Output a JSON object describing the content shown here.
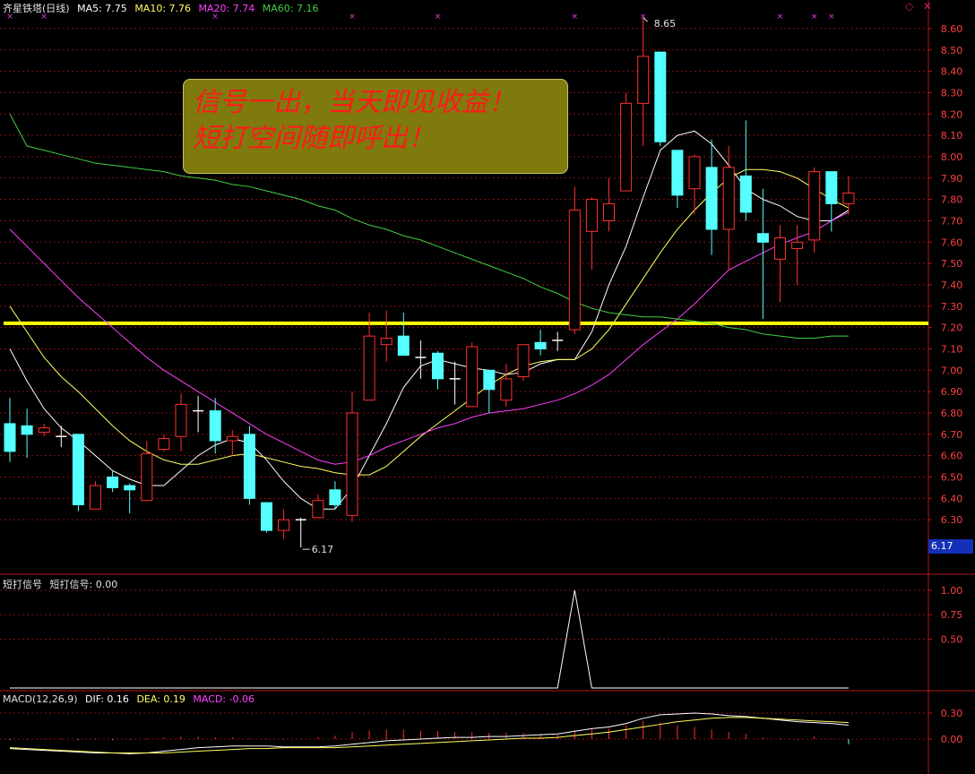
{
  "header": {
    "security_name": "齐星铁塔(日线)",
    "ma5_label": "MA5: 7.75",
    "ma10_label": "MA10: 7.76",
    "ma20_label": "MA20: 7.74",
    "ma60_label": "MA60: 7.16"
  },
  "banner": {
    "line1": "信号一出，当天即见收益！",
    "line2": "短打空间随即呼出！"
  },
  "current_price_tag": "6.17",
  "signal_panel": {
    "title": "短打信号",
    "value_label": "短打信号: 0.00"
  },
  "macd_panel": {
    "title": "MACD(12,26,9)",
    "dif_label": "DIF: 0.16",
    "dea_label": "DEA: 0.19",
    "macd_label": "MACD: -0.06"
  },
  "colors": {
    "up": "#ff3030",
    "down": "#54ffff",
    "ma5": "#ffffff",
    "ma10": "#ffff60",
    "ma20": "#ff40ff",
    "ma60": "#40d040",
    "support_line": "#ffff00",
    "grid": "#8a1010"
  },
  "chart_data": [
    {
      "type": "candlestick",
      "title": "齐星铁塔(日线)",
      "ylim": [
        6.2,
        8.65
      ],
      "yticks": [
        6.3,
        6.4,
        6.5,
        6.6,
        6.7,
        6.8,
        6.9,
        7.0,
        7.1,
        7.2,
        7.3,
        7.4,
        7.5,
        7.6,
        7.7,
        7.8,
        7.9,
        8.0,
        8.1,
        8.2,
        8.3,
        8.4,
        8.5,
        8.6
      ],
      "max_label": "8.65",
      "min_label": "6.17",
      "support_level": 7.22,
      "candles": [
        {
          "o": 6.75,
          "h": 6.87,
          "l": 6.57,
          "c": 6.62
        },
        {
          "o": 6.74,
          "h": 6.82,
          "l": 6.59,
          "c": 6.7
        },
        {
          "o": 6.71,
          "h": 6.75,
          "l": 6.69,
          "c": 6.73
        },
        {
          "o": 6.69,
          "h": 6.74,
          "l": 6.64,
          "c": 6.69
        },
        {
          "o": 6.7,
          "h": 6.7,
          "l": 6.34,
          "c": 6.37
        },
        {
          "o": 6.35,
          "h": 6.48,
          "l": 6.35,
          "c": 6.46
        },
        {
          "o": 6.5,
          "h": 6.53,
          "l": 6.43,
          "c": 6.45
        },
        {
          "o": 6.46,
          "h": 6.47,
          "l": 6.33,
          "c": 6.44
        },
        {
          "o": 6.39,
          "h": 6.67,
          "l": 6.39,
          "c": 6.61
        },
        {
          "o": 6.63,
          "h": 6.7,
          "l": 6.62,
          "c": 6.68
        },
        {
          "o": 6.69,
          "h": 6.89,
          "l": 6.62,
          "c": 6.84
        },
        {
          "o": 6.81,
          "h": 6.88,
          "l": 6.71,
          "c": 6.81
        },
        {
          "o": 6.81,
          "h": 6.87,
          "l": 6.61,
          "c": 6.67
        },
        {
          "o": 6.67,
          "h": 6.72,
          "l": 6.6,
          "c": 6.69
        },
        {
          "o": 6.7,
          "h": 6.74,
          "l": 6.37,
          "c": 6.4
        },
        {
          "o": 6.38,
          "h": 6.38,
          "l": 6.24,
          "c": 6.25
        },
        {
          "o": 6.25,
          "h": 6.35,
          "l": 6.21,
          "c": 6.3
        },
        {
          "o": 6.3,
          "h": 6.31,
          "l": 6.17,
          "c": 6.3
        },
        {
          "o": 6.31,
          "h": 6.42,
          "l": 6.31,
          "c": 6.39
        },
        {
          "o": 6.44,
          "h": 6.48,
          "l": 6.35,
          "c": 6.37
        },
        {
          "o": 6.32,
          "h": 6.9,
          "l": 6.29,
          "c": 6.8
        },
        {
          "o": 6.86,
          "h": 7.27,
          "l": 6.86,
          "c": 7.16
        },
        {
          "o": 7.12,
          "h": 7.28,
          "l": 7.04,
          "c": 7.15
        },
        {
          "o": 7.16,
          "h": 7.27,
          "l": 7.07,
          "c": 7.07
        },
        {
          "o": 7.06,
          "h": 7.14,
          "l": 6.96,
          "c": 7.06
        },
        {
          "o": 7.08,
          "h": 7.09,
          "l": 6.91,
          "c": 6.96
        },
        {
          "o": 6.96,
          "h": 7.04,
          "l": 6.84,
          "c": 6.96
        },
        {
          "o": 6.83,
          "h": 7.13,
          "l": 6.83,
          "c": 7.11
        },
        {
          "o": 7.0,
          "h": 7.0,
          "l": 6.8,
          "c": 6.91
        },
        {
          "o": 6.86,
          "h": 7.03,
          "l": 6.83,
          "c": 6.96
        },
        {
          "o": 6.97,
          "h": 7.12,
          "l": 6.95,
          "c": 7.12
        },
        {
          "o": 7.13,
          "h": 7.19,
          "l": 7.07,
          "c": 7.1
        },
        {
          "o": 7.14,
          "h": 7.18,
          "l": 7.09,
          "c": 7.13
        },
        {
          "o": 7.19,
          "h": 7.86,
          "l": 7.17,
          "c": 7.75
        },
        {
          "o": 7.65,
          "h": 7.81,
          "l": 7.47,
          "c": 7.8
        },
        {
          "o": 7.7,
          "h": 7.9,
          "l": 7.65,
          "c": 7.78
        },
        {
          "o": 7.84,
          "h": 8.3,
          "l": 7.84,
          "c": 8.25
        },
        {
          "o": 8.25,
          "h": 8.65,
          "l": 8.05,
          "c": 8.47
        },
        {
          "o": 8.49,
          "h": 8.49,
          "l": 8.05,
          "c": 8.07
        },
        {
          "o": 8.03,
          "h": 8.03,
          "l": 7.76,
          "c": 7.82
        },
        {
          "o": 7.85,
          "h": 8.01,
          "l": 7.73,
          "c": 8.0
        },
        {
          "o": 7.95,
          "h": 8.08,
          "l": 7.54,
          "c": 7.66
        },
        {
          "o": 7.66,
          "h": 8.05,
          "l": 7.47,
          "c": 7.95
        },
        {
          "o": 7.91,
          "h": 8.17,
          "l": 7.7,
          "c": 7.74
        },
        {
          "o": 7.64,
          "h": 7.85,
          "l": 7.24,
          "c": 7.6
        },
        {
          "o": 7.52,
          "h": 7.68,
          "l": 7.32,
          "c": 7.62
        },
        {
          "o": 7.57,
          "h": 7.68,
          "l": 7.4,
          "c": 7.6
        },
        {
          "o": 7.61,
          "h": 7.95,
          "l": 7.55,
          "c": 7.93
        },
        {
          "o": 7.93,
          "h": 7.93,
          "l": 7.65,
          "c": 7.78
        },
        {
          "o": 7.78,
          "h": 7.91,
          "l": 7.73,
          "c": 7.83
        }
      ],
      "markers_x": [
        0,
        2,
        12,
        20,
        25,
        33,
        37,
        45,
        47,
        48
      ],
      "series": [
        {
          "name": "MA5",
          "values": [
            7.1,
            6.95,
            6.82,
            6.73,
            6.67,
            6.6,
            6.53,
            6.49,
            6.46,
            6.46,
            6.53,
            6.6,
            6.65,
            6.68,
            6.66,
            6.58,
            6.48,
            6.4,
            6.35,
            6.35,
            6.45,
            6.6,
            6.75,
            6.92,
            7.02,
            7.05,
            7.03,
            7.01,
            7.0,
            6.98,
            6.99,
            7.03,
            7.05,
            7.05,
            7.18,
            7.4,
            7.58,
            7.81,
            8.03,
            8.1,
            8.12,
            8.06,
            7.96,
            7.85,
            7.8,
            7.77,
            7.72,
            7.7,
            7.7,
            7.75
          ]
        },
        {
          "name": "MA10",
          "values": [
            7.3,
            7.18,
            7.06,
            6.97,
            6.9,
            6.82,
            6.74,
            6.67,
            6.62,
            6.58,
            6.56,
            6.56,
            6.58,
            6.6,
            6.61,
            6.59,
            6.57,
            6.55,
            6.54,
            6.52,
            6.51,
            6.51,
            6.55,
            6.62,
            6.69,
            6.75,
            6.81,
            6.87,
            6.93,
            6.98,
            7.02,
            7.04,
            7.05,
            7.05,
            7.1,
            7.19,
            7.31,
            7.43,
            7.55,
            7.66,
            7.75,
            7.83,
            7.9,
            7.94,
            7.94,
            7.93,
            7.9,
            7.85,
            7.8,
            7.76
          ]
        },
        {
          "name": "MA20",
          "values": [
            7.66,
            7.58,
            7.5,
            7.42,
            7.34,
            7.27,
            7.2,
            7.13,
            7.06,
            7.0,
            6.95,
            6.9,
            6.85,
            6.8,
            6.75,
            6.7,
            6.66,
            6.62,
            6.58,
            6.56,
            6.57,
            6.6,
            6.64,
            6.67,
            6.7,
            6.73,
            6.75,
            6.78,
            6.8,
            6.81,
            6.82,
            6.84,
            6.86,
            6.89,
            6.93,
            6.98,
            7.05,
            7.12,
            7.18,
            7.24,
            7.31,
            7.39,
            7.47,
            7.51,
            7.55,
            7.59,
            7.62,
            7.65,
            7.7,
            7.74
          ]
        },
        {
          "name": "MA60",
          "values": [
            8.2,
            8.05,
            8.03,
            8.01,
            7.99,
            7.97,
            7.96,
            7.95,
            7.94,
            7.93,
            7.91,
            7.9,
            7.89,
            7.87,
            7.86,
            7.84,
            7.82,
            7.8,
            7.77,
            7.75,
            7.71,
            7.68,
            7.66,
            7.63,
            7.61,
            7.58,
            7.55,
            7.52,
            7.49,
            7.46,
            7.43,
            7.39,
            7.36,
            7.32,
            7.29,
            7.27,
            7.26,
            7.25,
            7.25,
            7.24,
            7.23,
            7.22,
            7.2,
            7.19,
            7.17,
            7.16,
            7.15,
            7.15,
            7.16,
            7.16
          ]
        }
      ]
    },
    {
      "type": "line",
      "title": "短打信号",
      "ylim": [
        0,
        1.1
      ],
      "yticks": [
        0.5,
        0.75,
        1.0
      ],
      "values": [
        0,
        0,
        0,
        0,
        0,
        0,
        0,
        0,
        0,
        0,
        0,
        0,
        0,
        0,
        0,
        0,
        0,
        0,
        0,
        0,
        0,
        0,
        0,
        0,
        0,
        0,
        0,
        0,
        0,
        0,
        0,
        0,
        0,
        1,
        0,
        0,
        0,
        0,
        0,
        0,
        0,
        0,
        0,
        0,
        0,
        0,
        0,
        0,
        0,
        0
      ]
    },
    {
      "type": "bar",
      "title": "MACD(12,26,9)",
      "ylim": [
        -0.12,
        0.4
      ],
      "yticks": [
        0.0,
        0.3
      ],
      "macd": [
        -0.01,
        -0.005,
        0.005,
        0.01,
        -0.01,
        -0.005,
        -0.01,
        -0.005,
        0.01,
        0.02,
        0.03,
        0.03,
        0.02,
        0.02,
        0.01,
        0.005,
        -0.005,
        0.005,
        0.02,
        0.04,
        0.08,
        0.1,
        0.11,
        0.11,
        0.1,
        0.09,
        0.08,
        0.08,
        0.07,
        0.07,
        0.07,
        0.06,
        0.05,
        0.1,
        0.11,
        0.12,
        0.16,
        0.21,
        0.19,
        0.16,
        0.14,
        0.11,
        0.08,
        0.06,
        0.02,
        0.01,
        -0.005,
        0.03,
        0.005,
        -0.06
      ],
      "series": [
        {
          "name": "DIF",
          "values": [
            -0.11,
            -0.12,
            -0.13,
            -0.14,
            -0.15,
            -0.16,
            -0.16,
            -0.17,
            -0.16,
            -0.14,
            -0.12,
            -0.1,
            -0.09,
            -0.08,
            -0.08,
            -0.08,
            -0.09,
            -0.09,
            -0.09,
            -0.08,
            -0.06,
            -0.04,
            -0.02,
            -0.01,
            0.0,
            0.01,
            0.02,
            0.02,
            0.03,
            0.03,
            0.04,
            0.05,
            0.06,
            0.09,
            0.12,
            0.14,
            0.18,
            0.24,
            0.28,
            0.29,
            0.3,
            0.29,
            0.27,
            0.26,
            0.24,
            0.22,
            0.2,
            0.19,
            0.18,
            0.16
          ]
        },
        {
          "name": "DEA",
          "values": [
            -0.1,
            -0.11,
            -0.12,
            -0.13,
            -0.14,
            -0.15,
            -0.16,
            -0.16,
            -0.16,
            -0.16,
            -0.15,
            -0.14,
            -0.13,
            -0.12,
            -0.11,
            -0.11,
            -0.1,
            -0.1,
            -0.1,
            -0.1,
            -0.09,
            -0.08,
            -0.07,
            -0.06,
            -0.05,
            -0.04,
            -0.03,
            -0.02,
            -0.01,
            0.0,
            0.01,
            0.01,
            0.02,
            0.04,
            0.06,
            0.08,
            0.11,
            0.14,
            0.17,
            0.2,
            0.22,
            0.24,
            0.25,
            0.25,
            0.24,
            0.23,
            0.22,
            0.21,
            0.2,
            0.19
          ]
        }
      ]
    }
  ]
}
